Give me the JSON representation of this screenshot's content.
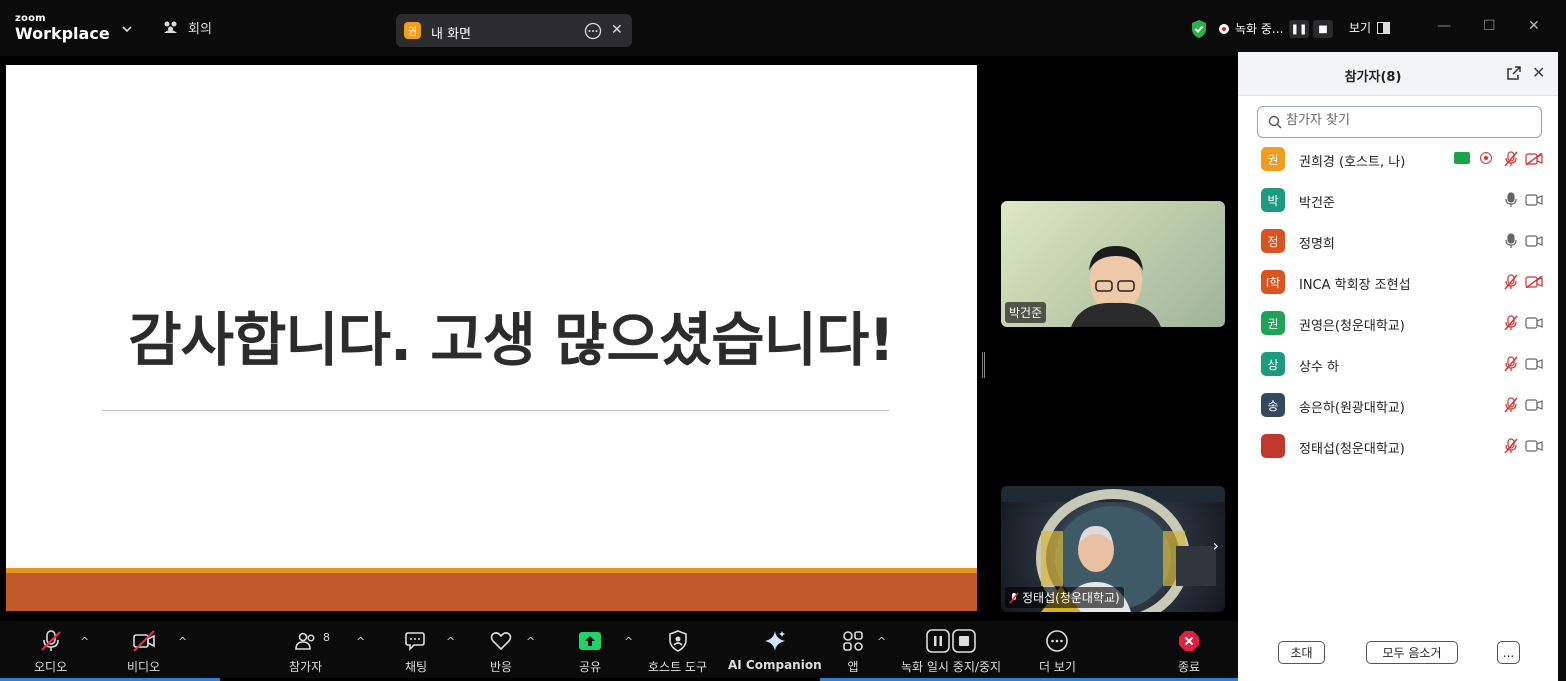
{
  "topbar": {
    "logo_small": "zoom",
    "logo_big": "Workplace",
    "meeting_label": "회의",
    "share_avatar": "권",
    "share_label": "내 화면",
    "recording_label": "녹화 중...",
    "view_label": "보기"
  },
  "slide": {
    "title": "감사합니다. 고생 많으셨습니다!"
  },
  "videos": [
    {
      "name": "박건준"
    },
    {
      "name": "정태섭(청운대학교)"
    }
  ],
  "toolbar": {
    "audio": "오디오",
    "video": "비디오",
    "participants": "참가자",
    "participants_count": "8",
    "chat": "채팅",
    "reactions": "반응",
    "share": "공유",
    "host_tools": "호스트 도구",
    "ai_companion": "AI Companion",
    "apps": "앱",
    "recording": "녹화 일시 중지/중지",
    "more": "더 보기",
    "end": "종료"
  },
  "panel": {
    "title": "참가자(8)",
    "search_placeholder": "참가자 찾기",
    "invite": "초대",
    "mute_all": "모두 음소거",
    "more": "..."
  },
  "participants": [
    {
      "avatar": "권",
      "name": "권희경 (호스트, 나)",
      "color": "#f29d1b",
      "mic": "muted",
      "cam": "off"
    },
    {
      "avatar": "박",
      "name": "박건준",
      "color": "#1e9b7e",
      "mic": "on",
      "cam": "on"
    },
    {
      "avatar": "정",
      "name": "정명희",
      "color": "#d9541e",
      "mic": "on",
      "cam": "on"
    },
    {
      "avatar": "I학",
      "name": "INCA 학회장 조현섭",
      "color": "#d9541e",
      "mic": "muted",
      "cam": "off"
    },
    {
      "avatar": "권",
      "name": "권영은(청운대학교)",
      "color": "#1fa35a",
      "mic": "muted",
      "cam": "on"
    },
    {
      "avatar": "상",
      "name": "상수 하",
      "color": "#1e9b7e",
      "mic": "muted",
      "cam": "on"
    },
    {
      "avatar": "송",
      "name": "송은하(원광대학교)",
      "color": "#34495e",
      "mic": "muted",
      "cam": "on"
    },
    {
      "avatar": "",
      "name": "정태섭(청운대학교)",
      "color": "#c0392b",
      "mic": "muted",
      "cam": "on"
    }
  ],
  "colors": {
    "accent_green": "#1aa34a",
    "muted_red": "#d33131",
    "slide_band": "#c05a2b",
    "slide_band_top": "#e8961e"
  }
}
